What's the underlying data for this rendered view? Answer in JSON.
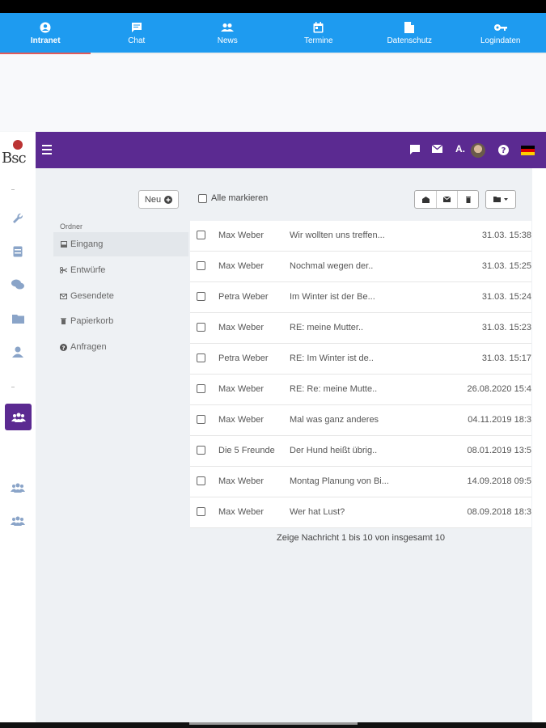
{
  "topnav": {
    "tabs": [
      {
        "label": "Intranet",
        "icon": "account-circle-icon",
        "active": true
      },
      {
        "label": "Chat",
        "icon": "chat-icon",
        "active": false
      },
      {
        "label": "News",
        "icon": "people-icon",
        "active": false
      },
      {
        "label": "Termine",
        "icon": "calendar-icon",
        "active": false
      },
      {
        "label": "Datenschutz",
        "icon": "document-icon",
        "active": false
      },
      {
        "label": "Logindaten",
        "icon": "key-icon",
        "active": false
      }
    ]
  },
  "logo": {
    "text": "Bsc"
  },
  "header": {
    "user": "A.",
    "icons": [
      "chat-bubble-icon",
      "mail-icon",
      "help-icon"
    ],
    "language_flag": "german-flag-icon"
  },
  "sidebar": {
    "icons": [
      "wrench-icon",
      "storage-icon",
      "comments-icon",
      "folder-icon",
      "user-icon",
      "users-icon",
      "group-icon",
      "group-icon"
    ]
  },
  "toolbar": {
    "new_label": "Neu",
    "mark_all_label": "Alle markieren"
  },
  "folders": {
    "heading": "Ordner",
    "items": [
      {
        "label": "Eingang",
        "icon": "inbox-icon",
        "active": true
      },
      {
        "label": "Entwürfe",
        "icon": "scissors-icon",
        "active": false
      },
      {
        "label": "Gesendete",
        "icon": "envelope-icon",
        "active": false
      },
      {
        "label": "Papierkorb",
        "icon": "trash-icon",
        "active": false
      },
      {
        "label": "Anfragen",
        "icon": "question-icon",
        "active": false
      }
    ]
  },
  "messages": [
    {
      "from": "Max Weber",
      "subject": "Wir wollten uns treffen...",
      "date": "31.03. 15:38"
    },
    {
      "from": "Max Weber",
      "subject": "Nochmal wegen der..",
      "date": "31.03. 15:25"
    },
    {
      "from": "Petra Weber",
      "subject": "Im Winter ist der Be...",
      "date": "31.03. 15:24"
    },
    {
      "from": "Max Weber",
      "subject": "RE: meine Mutter..",
      "date": "31.03. 15:23"
    },
    {
      "from": "Petra Weber",
      "subject": "RE: Im Winter ist de..",
      "date": "31.03. 15:17"
    },
    {
      "from": "Max Weber",
      "subject": "RE: Re: meine Mutte..",
      "date": "26.08.2020 15:4"
    },
    {
      "from": "Max Weber",
      "subject": "Mal was ganz anderes",
      "date": "04.11.2019 18:3"
    },
    {
      "from": "Die 5 Freunde",
      "subject": "Der Hund heißt übrig..",
      "date": "08.01.2019 13:5"
    },
    {
      "from": "Max Weber",
      "subject": "Montag Planung von Bi...",
      "date": "14.09.2018 09:5"
    },
    {
      "from": "Max Weber",
      "subject": "Wer hat Lust?",
      "date": "08.09.2018 18:3"
    }
  ],
  "pagination": {
    "text": "Zeige Nachricht 1 bis 10 von insgesamt 10"
  },
  "colors": {
    "nav_blue": "#1e9bf0",
    "header_purple": "#5b2a91",
    "active_tab_underline": "#e05a5a"
  }
}
